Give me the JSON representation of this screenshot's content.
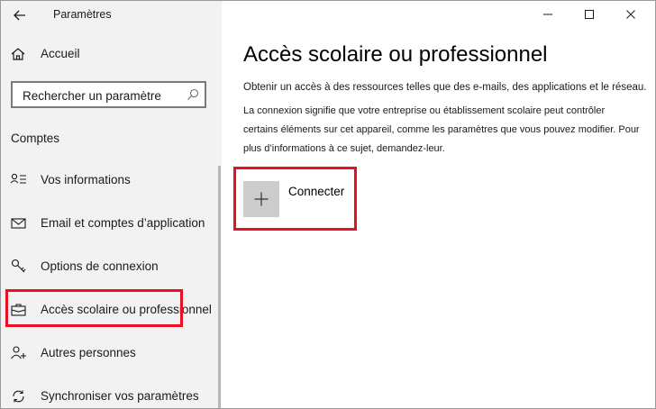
{
  "window": {
    "title": "Paramètres"
  },
  "sidebar": {
    "home_label": "Accueil",
    "search_placeholder": "Rechercher un paramètre",
    "section_title": "Comptes",
    "items": [
      {
        "label": "Vos informations",
        "icon": "person-list-icon"
      },
      {
        "label": "Email et comptes d’application",
        "icon": "mail-icon"
      },
      {
        "label": "Options de connexion",
        "icon": "key-icon"
      },
      {
        "label": "Accès scolaire ou professionnel",
        "icon": "briefcase-icon",
        "selected": true
      },
      {
        "label": "Autres personnes",
        "icon": "person-add-icon"
      },
      {
        "label": "Synchroniser vos paramètres",
        "icon": "sync-icon"
      }
    ]
  },
  "main": {
    "title": "Accès scolaire ou professionnel",
    "description_line1": "Obtenir un accès à des ressources telles que des e-mails, des applications et le réseau.",
    "description_line2": "La connexion signifie que votre entreprise ou établissement scolaire peut contrôler certains éléments sur cet appareil, comme les paramètres que vous pouvez modifier. Pour plus d’informations à ce sujet, demandez-leur.",
    "connect_label": "Connecter"
  },
  "colors": {
    "highlight": "#e81123",
    "sidebar_bg": "#f2f2f2",
    "tile_bg": "#cccccc"
  }
}
